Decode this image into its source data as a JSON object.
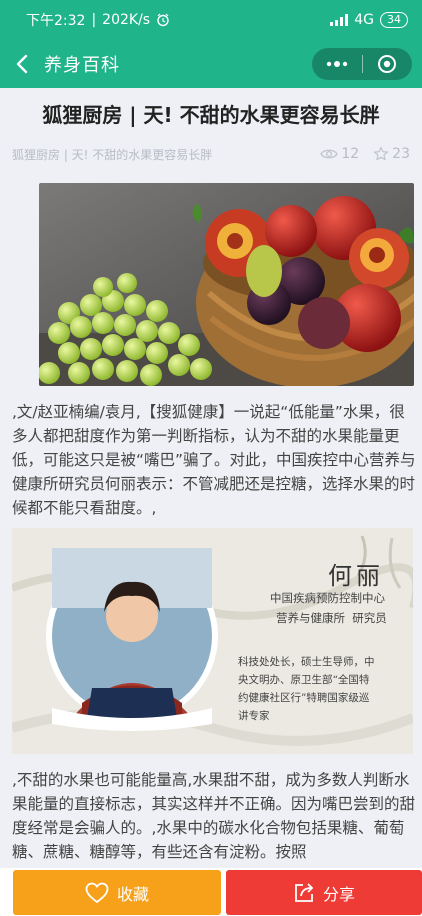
{
  "status": {
    "time": "下午2:32",
    "speed": "202K/s",
    "network": "4G",
    "battery": "34"
  },
  "nav": {
    "title": "养身百科"
  },
  "article": {
    "title": "狐狸厨房 | 天! 不甜的水果更容易长胖",
    "subtitle": "狐狸厨房 | 天! 不甜的水果更容易长胖",
    "views": "12",
    "favorites": "23",
    "para1": ",文/赵亚楠编/袁月,【搜狐健康】一说起“低能量”水果，很多人都把甜度作为第一判断指标，认为不甜的水果能量更低，可能这只是被“嘴巴”骗了。对此，中国疾控中心营养与健康所研究员何丽表示：不管减肥还是控糖，选择水果的时候都不能只看甜度。,",
    "para2": ",不甜的水果也可能能量高,水果甜不甜，成为多数人判断水果能量的直接标志，其实这样并不正确。因为嘴巴尝到的甜度经常是会骗人的。,水果中的碳水化合物包括果糖、葡萄糖、蔗糖、糖醇等，有些还含有淀粉。按照"
  },
  "card": {
    "name": "何丽",
    "org1": "中国疾病预防控制中心",
    "org2": "营养与健康所  研究员",
    "bio1": "科技处处长，硕士生导师，中",
    "bio2": "央文明办、原卫生部“全国特",
    "bio3": "约健康社区行”特聘国家级巡",
    "bio4": "讲专家"
  },
  "buttons": {
    "favorite": "收藏",
    "share": "分享"
  },
  "colors": {
    "theme": "#20b48a",
    "favorite": "#f7a11b",
    "share": "#ee3b35"
  }
}
